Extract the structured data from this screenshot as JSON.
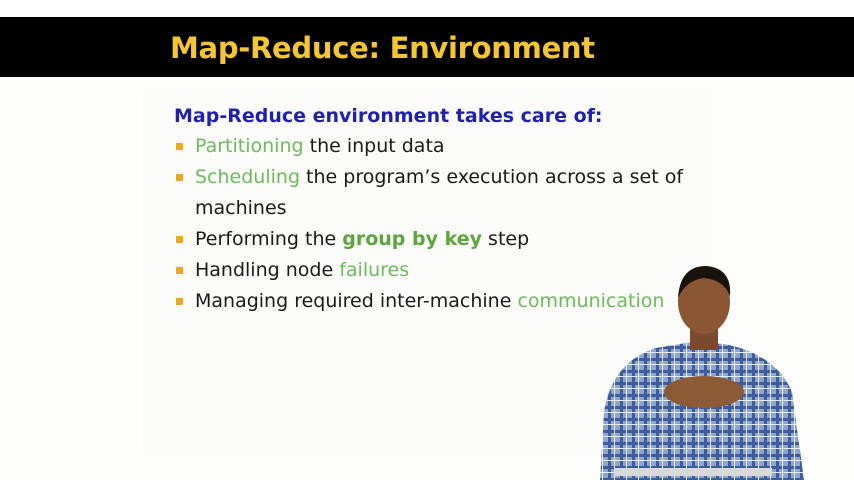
{
  "slide": {
    "title": "Map-Reduce: Environment",
    "heading": "Map-Reduce environment takes care of:",
    "bullets": [
      {
        "hl": "Partitioning",
        "rest": " the input data"
      },
      {
        "hl": "Scheduling",
        "rest": " the program’s execution across a set of machines"
      },
      {
        "pre": "Performing the ",
        "hl": "group by key",
        "rest": " step"
      },
      {
        "pre": "Handling node ",
        "hl": "failures"
      },
      {
        "pre": "Managing required inter-machine ",
        "hl": "communication"
      }
    ]
  },
  "colors": {
    "title_bar": "#000000",
    "title_text": "#f6c62c",
    "heading_text": "#1f1fb4",
    "highlight": "#6cbb5a",
    "bullet_square": "#f0a818"
  }
}
